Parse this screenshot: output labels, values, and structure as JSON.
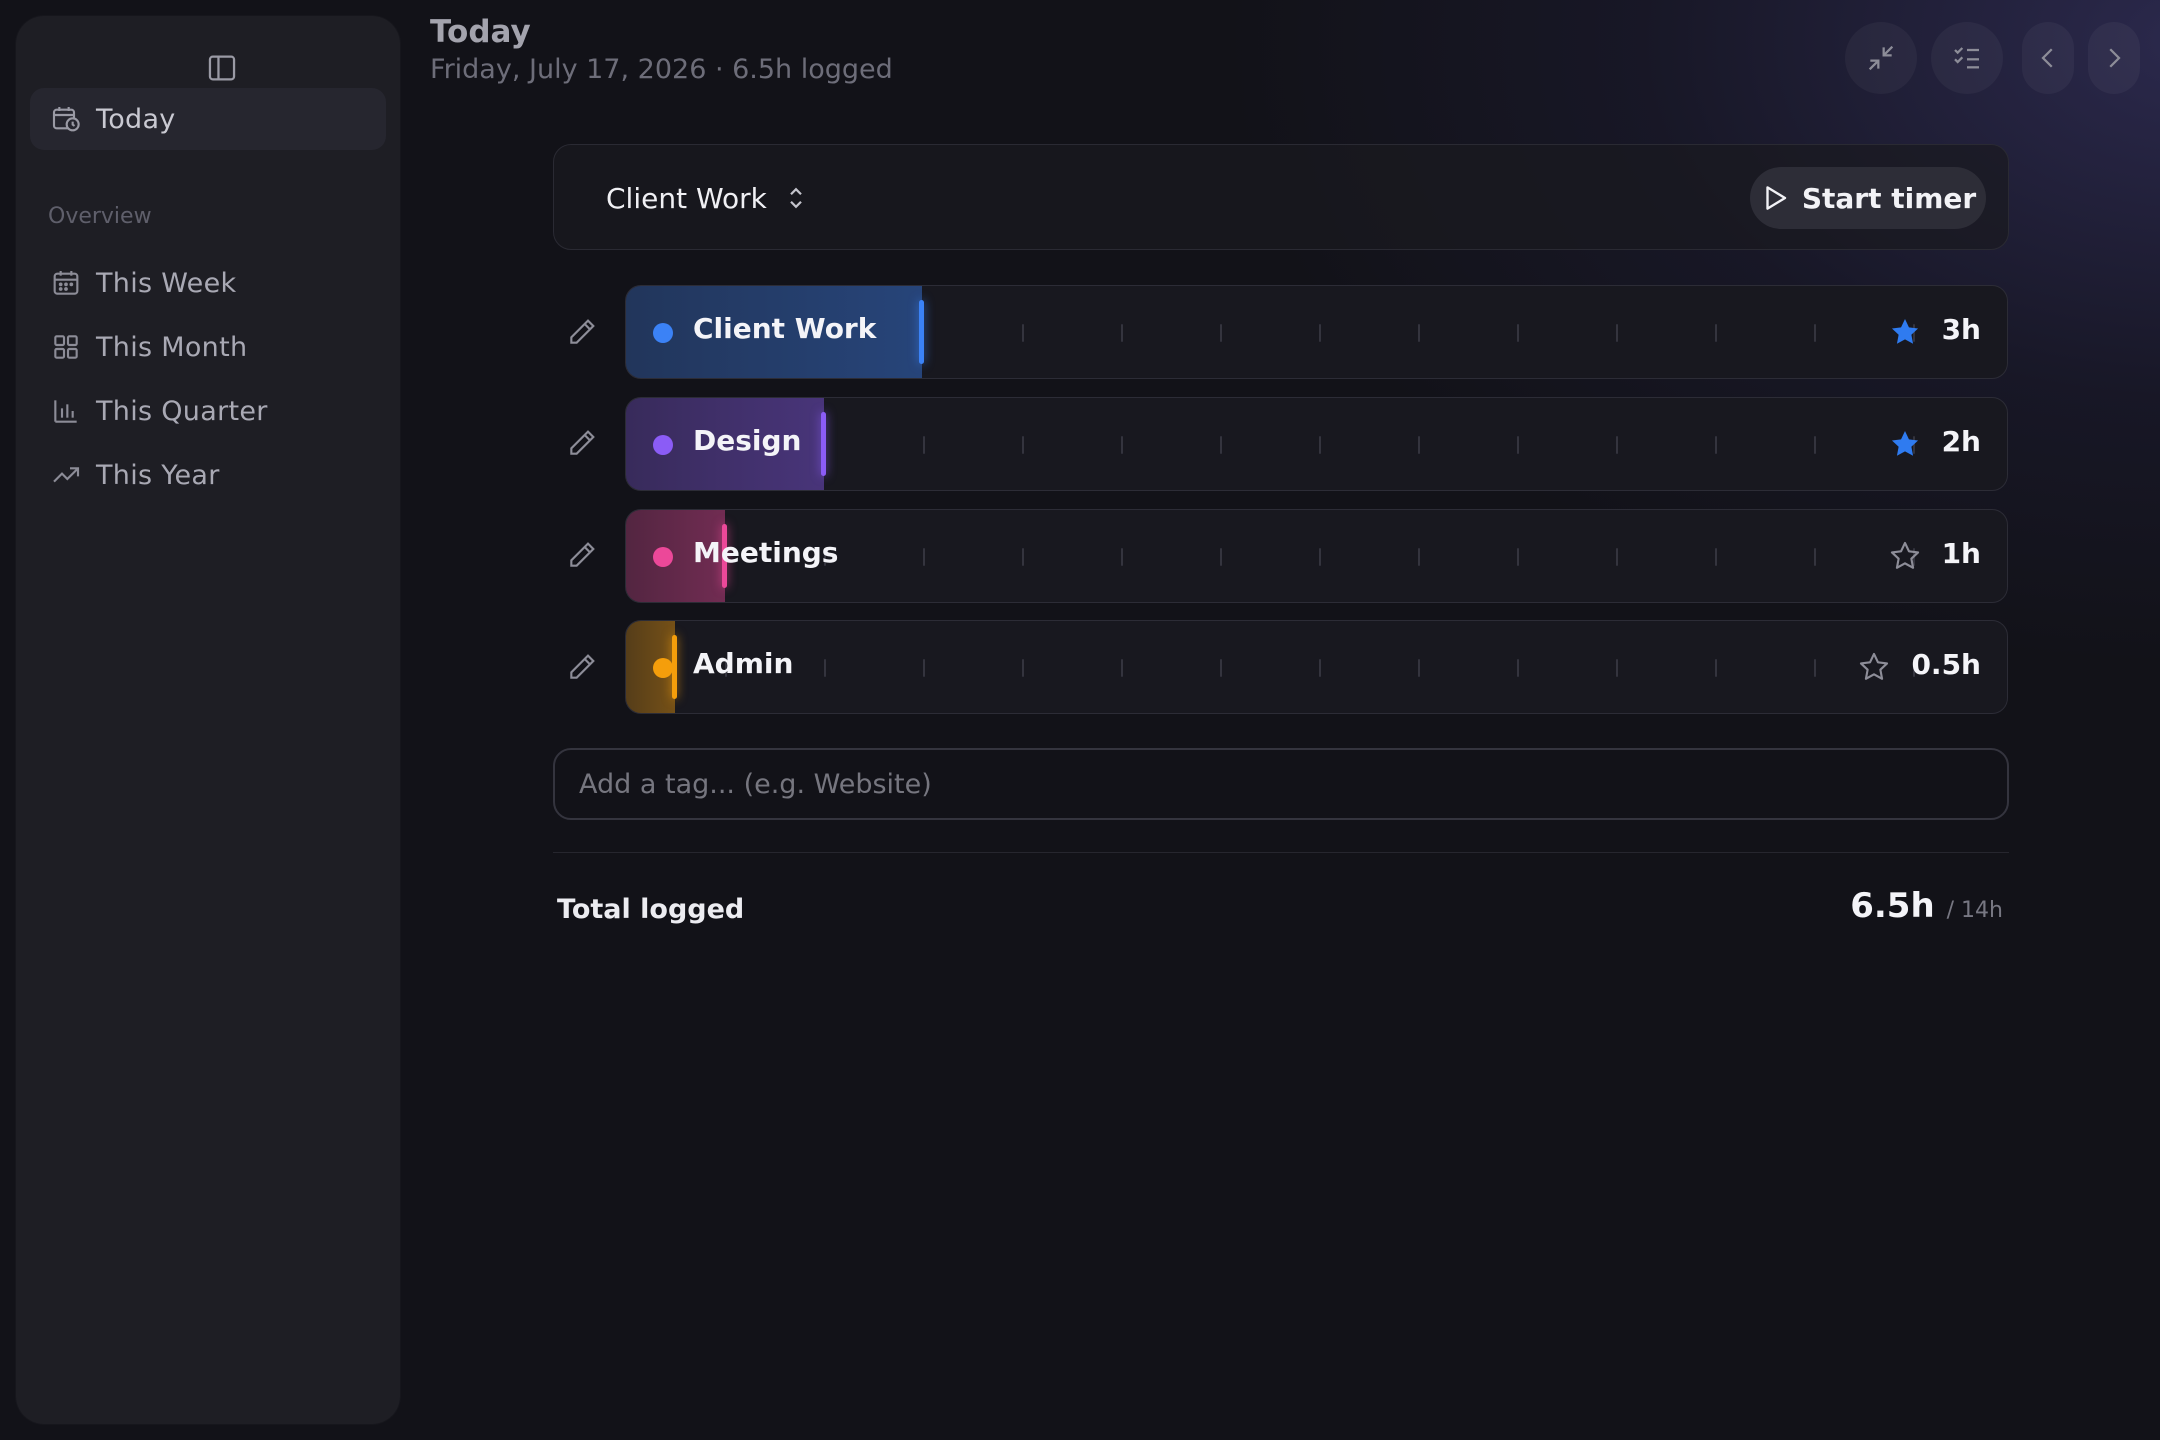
{
  "header": {
    "title": "Today",
    "subtitle": "Friday, July 17, 2026 · 6.5h logged"
  },
  "sidebar": {
    "today_label": "Today",
    "section_label": "Overview",
    "items": [
      {
        "label": "This Week",
        "icon": "calendar-icon"
      },
      {
        "label": "This Month",
        "icon": "grid-icon"
      },
      {
        "label": "This Quarter",
        "icon": "bar-chart-icon"
      },
      {
        "label": "This Year",
        "icon": "trending-up-icon"
      }
    ]
  },
  "toolbar": {
    "icons": [
      "minimize-icon",
      "checklist-icon",
      "chevron-left-icon",
      "chevron-right-icon"
    ]
  },
  "selector": {
    "project": "Client Work",
    "start_label": "Start timer"
  },
  "entries": [
    {
      "name": "Client Work",
      "hours": "3h",
      "value": 3,
      "starred": true,
      "color": "#3b82f6"
    },
    {
      "name": "Design",
      "hours": "2h",
      "value": 2,
      "starred": true,
      "color": "#8b5cf6"
    },
    {
      "name": "Meetings",
      "hours": "1h",
      "value": 1,
      "starred": false,
      "color": "#ec4899"
    },
    {
      "name": "Admin",
      "hours": "0.5h",
      "value": 0.5,
      "starred": false,
      "color": "#f59e0b"
    }
  ],
  "scale_max_hours": 14,
  "tag_input": {
    "placeholder": "Add a tag... (e.g. Website)",
    "value": ""
  },
  "total": {
    "label": "Total logged",
    "value": "6.5h",
    "capacity": "/ 14h"
  },
  "colors": {
    "accent_star": "#2f7bf0",
    "background": "#121218"
  }
}
